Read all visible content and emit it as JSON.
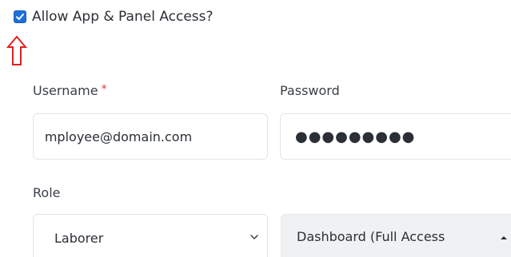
{
  "access": {
    "label": "Allow App & Panel Access?",
    "checked": true,
    "checkbox_color": "#1f6fd8",
    "annotation_arrow_color": "#e02020"
  },
  "form": {
    "username": {
      "label": "Username",
      "required_mark": "*",
      "value": "employee@domain.com"
    },
    "password": {
      "label": "Password",
      "masked_value": "●●●●●●●●●"
    },
    "role": {
      "label": "Role",
      "selected": "Laborer"
    },
    "dashboard": {
      "label": "Dashboard (Full Access"
    }
  },
  "icons": {
    "checkbox": "checkmark-icon",
    "arrow": "up-arrow-icon",
    "role_dropdown": "chevron-down-icon",
    "dashboard_dropdown": "caret-up-icon"
  }
}
